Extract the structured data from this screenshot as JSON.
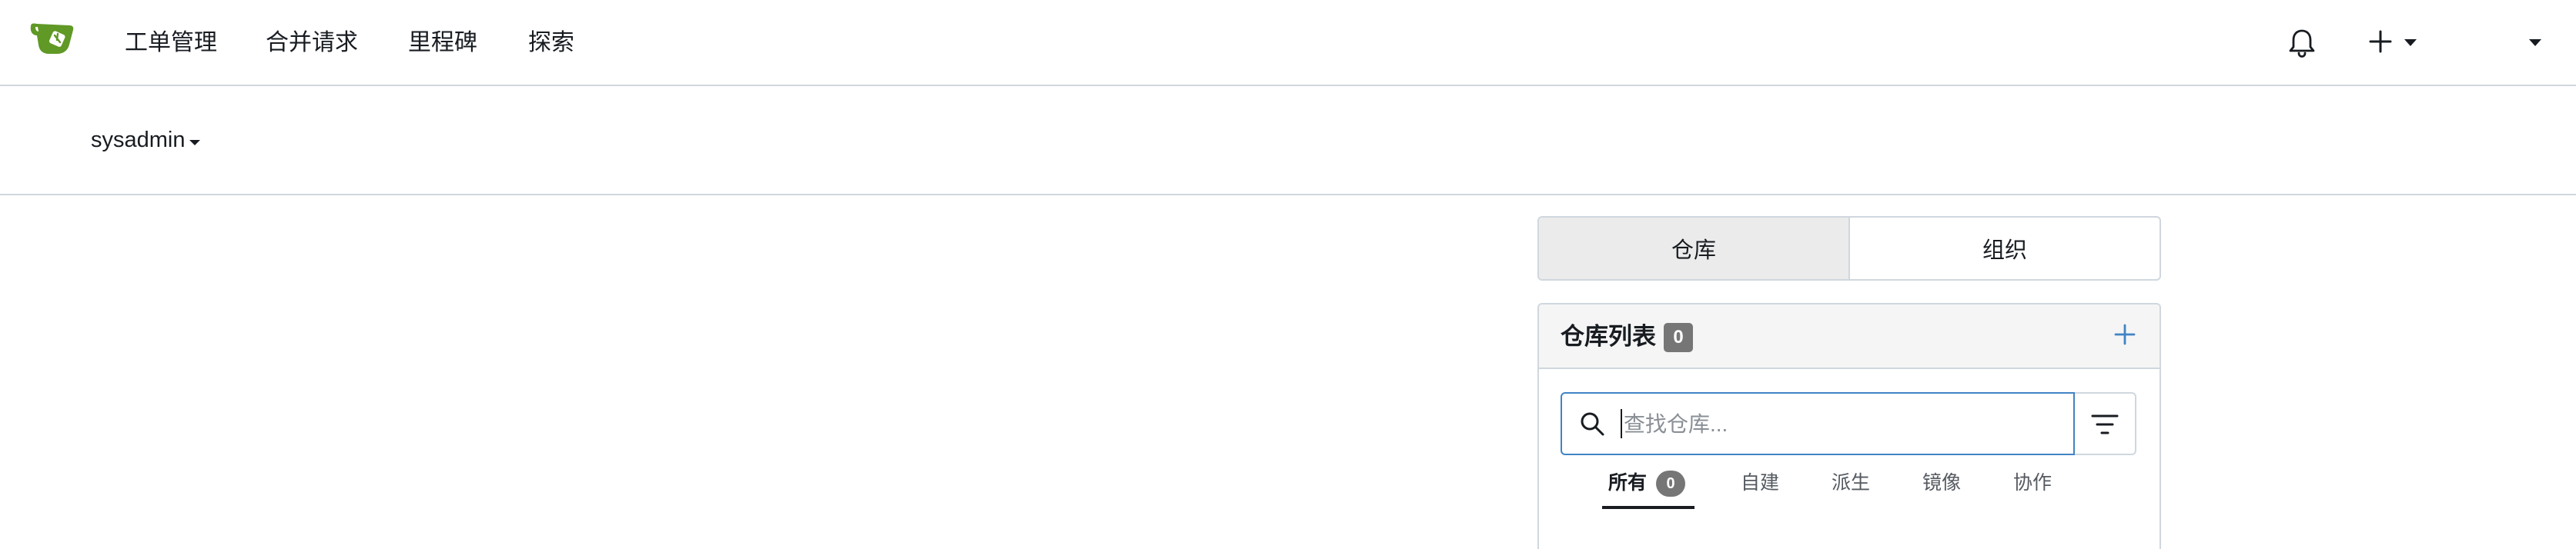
{
  "navbar": {
    "items": [
      "工单管理",
      "合并请求",
      "里程碑",
      "探索"
    ]
  },
  "context": {
    "user": "sysadmin"
  },
  "dashboard_tabs": [
    {
      "label": "仓库",
      "active": true
    },
    {
      "label": "组织",
      "active": false
    }
  ],
  "repo_panel": {
    "title": "仓库列表",
    "count": "0",
    "search_placeholder": "查找仓库...",
    "filter_tabs": [
      {
        "label": "所有",
        "count": "0",
        "active": true
      },
      {
        "label": "自建"
      },
      {
        "label": "派生"
      },
      {
        "label": "镜像"
      },
      {
        "label": "协作"
      }
    ]
  },
  "colors": {
    "accent": "#4183c4",
    "logo_green": "#609926",
    "badge": "#767676"
  },
  "icons": [
    "gitea-logo-icon",
    "bell-icon",
    "plus-icon",
    "chevron-down-icon",
    "search-icon",
    "filter-icon"
  ]
}
